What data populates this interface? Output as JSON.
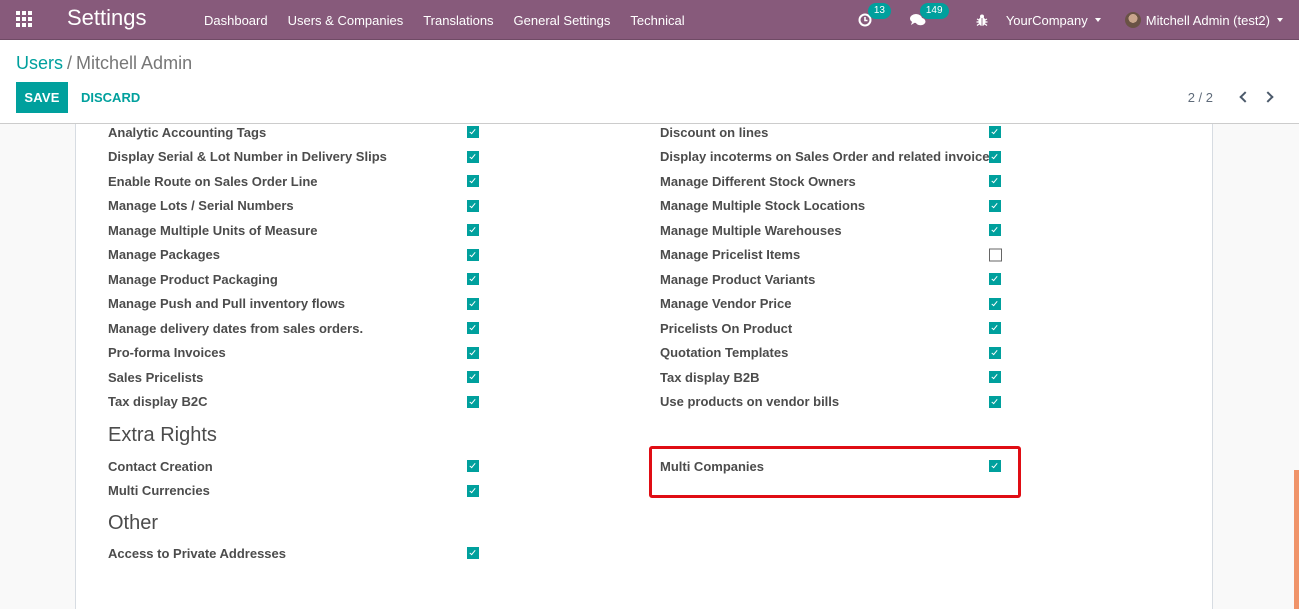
{
  "navbar": {
    "brand": "Settings",
    "menu": [
      "Dashboard",
      "Users & Companies",
      "Translations",
      "General Settings",
      "Technical"
    ],
    "activities_count": "13",
    "messages_count": "149",
    "company": "YourCompany",
    "user": "Mitchell Admin (test2)",
    "icons": [
      "apps-icon",
      "clock-icon",
      "chat-icon",
      "bug-icon",
      "caret-down-icon",
      "avatar"
    ]
  },
  "breadcrumb": {
    "parent": "Users",
    "separator": "/",
    "current": "Mitchell Admin"
  },
  "buttons": {
    "save": "SAVE",
    "discard": "DISCARD"
  },
  "pager": {
    "value": "2 / 2"
  },
  "technical_settings": {
    "left": [
      {
        "label": "Analytic Accounting Tags",
        "checked": true
      },
      {
        "label": "Display Serial & Lot Number in Delivery Slips",
        "checked": true
      },
      {
        "label": "Enable Route on Sales Order Line",
        "checked": true
      },
      {
        "label": "Manage Lots / Serial Numbers",
        "checked": true
      },
      {
        "label": "Manage Multiple Units of Measure",
        "checked": true
      },
      {
        "label": "Manage Packages",
        "checked": true
      },
      {
        "label": "Manage Product Packaging",
        "checked": true
      },
      {
        "label": "Manage Push and Pull inventory flows",
        "checked": true
      },
      {
        "label": "Manage delivery dates from sales orders.",
        "checked": true
      },
      {
        "label": "Pro-forma Invoices",
        "checked": true
      },
      {
        "label": "Sales Pricelists",
        "checked": true
      },
      {
        "label": "Tax display B2C",
        "checked": true
      }
    ],
    "right": [
      {
        "label": "Discount on lines",
        "checked": true
      },
      {
        "label": "Display incoterms on Sales Order and related invoices",
        "checked": true
      },
      {
        "label": "Manage Different Stock Owners",
        "checked": true
      },
      {
        "label": "Manage Multiple Stock Locations",
        "checked": true
      },
      {
        "label": "Manage Multiple Warehouses",
        "checked": true
      },
      {
        "label": "Manage Pricelist Items",
        "checked": false
      },
      {
        "label": "Manage Product Variants",
        "checked": true
      },
      {
        "label": "Manage Vendor Price",
        "checked": true
      },
      {
        "label": "Pricelists On Product",
        "checked": true
      },
      {
        "label": "Quotation Templates",
        "checked": true
      },
      {
        "label": "Tax display B2B",
        "checked": true
      },
      {
        "label": "Use products on vendor bills",
        "checked": true
      }
    ]
  },
  "extra_rights": {
    "title": "Extra Rights",
    "left": [
      {
        "label": "Contact Creation",
        "checked": true
      },
      {
        "label": "Multi Currencies",
        "checked": true
      }
    ],
    "right": [
      {
        "label": "Multi Companies",
        "checked": true
      }
    ]
  },
  "other": {
    "title": "Other",
    "left": [
      {
        "label": "Access to Private Addresses",
        "checked": true
      }
    ]
  },
  "colors": {
    "navbar": "#875a7b",
    "primary": "#00a09d",
    "highlight": "#e00d14",
    "scrollbar": "#f0946a"
  }
}
